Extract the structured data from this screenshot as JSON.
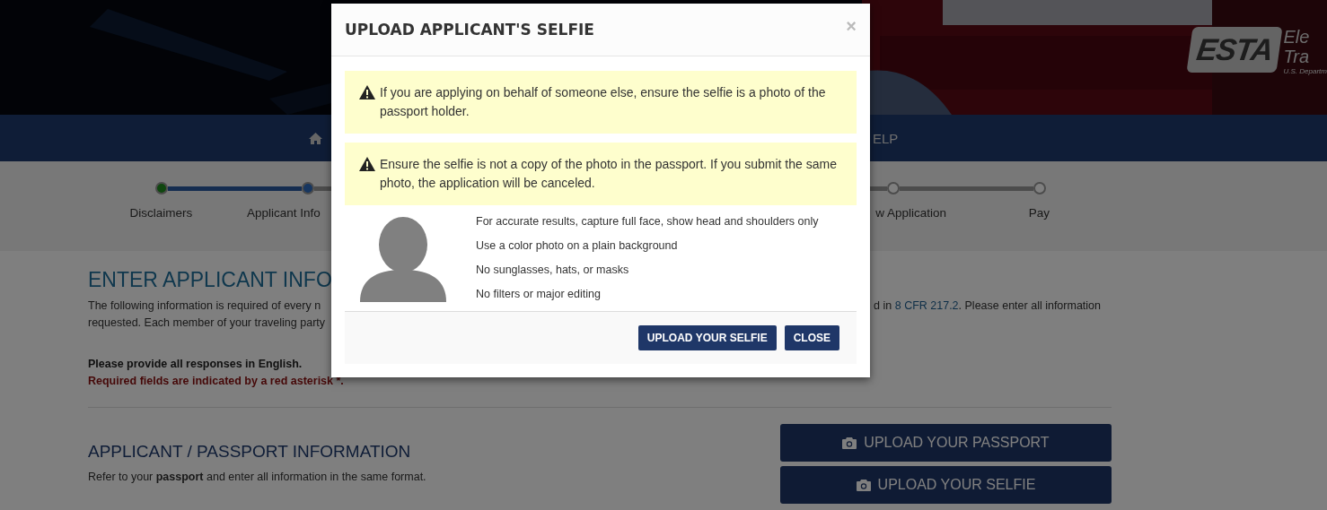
{
  "header": {
    "logo": {
      "mark": "ESTA",
      "lines": [
        "Ele",
        "Tra"
      ],
      "agency": "U.S. Departm"
    }
  },
  "nav": [
    {
      "label": "ELP"
    }
  ],
  "stepper": {
    "steps": [
      {
        "label": "Disclaimers",
        "kind": "done"
      },
      {
        "label": "Applicant Info",
        "kind": "current"
      },
      {
        "label": "w Application",
        "kind": "todo"
      },
      {
        "label": "Pay",
        "kind": "todo"
      }
    ]
  },
  "content": {
    "title": "ENTER APPLICANT INFO",
    "intro_left": [
      "The following information is required of every n",
      "requested. Each member of your traveling party"
    ],
    "intro_right": {
      "before": "d in ",
      "link": "8 CFR 217.2",
      "after": ". Please enter all information"
    },
    "english_note": "Please provide all responses in English.",
    "required_note": "Required fields are indicated by a red asterisk *.",
    "section_title": "APPLICANT / PASSPORT INFORMATION",
    "section_note": "Refer to your **passport** and enter all information in the same format."
  },
  "actions": [
    {
      "label": "UPLOAD YOUR PASSPORT"
    },
    {
      "label": "UPLOAD YOUR SELFIE"
    }
  ],
  "modal": {
    "title": "UPLOAD APPLICANT'S SELFIE",
    "close": "×",
    "alerts": [
      "If you are applying on behalf of someone else, ensure the selfie is a photo of the passport holder.",
      "Ensure the selfie is not a copy of the photo in the passport. If you submit the same photo, the application will be canceled."
    ],
    "guidelines": [
      "For accurate results, capture full face, show head and shoulders only",
      "Use a color photo on a plain background",
      "No sunglasses, hats, or masks",
      "No filters or major editing"
    ],
    "buttons": [
      "UPLOAD YOUR SELFIE",
      "CLOSE"
    ]
  }
}
